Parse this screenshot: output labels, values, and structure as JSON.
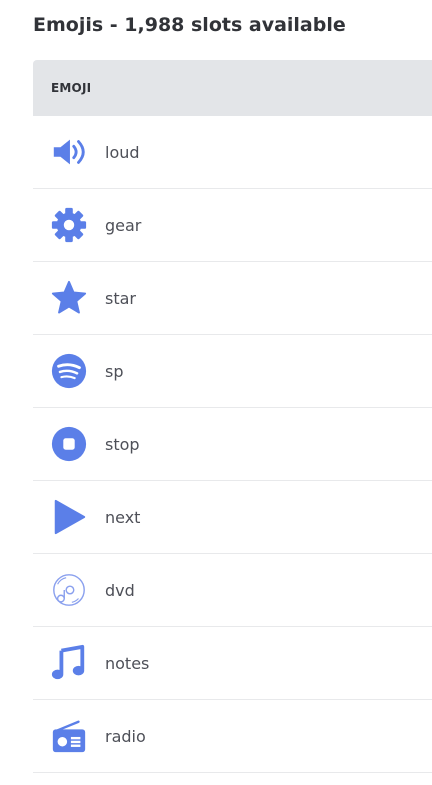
{
  "header": {
    "title": "Emojis - 1,988 slots available"
  },
  "table": {
    "column_header": "EMOJI",
    "rows": [
      {
        "name": "loud",
        "icon": "speaker-loud-icon"
      },
      {
        "name": "gear",
        "icon": "gear-icon"
      },
      {
        "name": "star",
        "icon": "star-icon"
      },
      {
        "name": "sp",
        "icon": "spotify-icon"
      },
      {
        "name": "stop",
        "icon": "stop-icon"
      },
      {
        "name": "next",
        "icon": "play-next-icon"
      },
      {
        "name": "dvd",
        "icon": "dvd-icon"
      },
      {
        "name": "notes",
        "icon": "music-notes-icon"
      },
      {
        "name": "radio",
        "icon": "radio-icon"
      }
    ]
  },
  "colors": {
    "icon_blue": "#5865f2",
    "header_bg": "#e3e5e8"
  }
}
